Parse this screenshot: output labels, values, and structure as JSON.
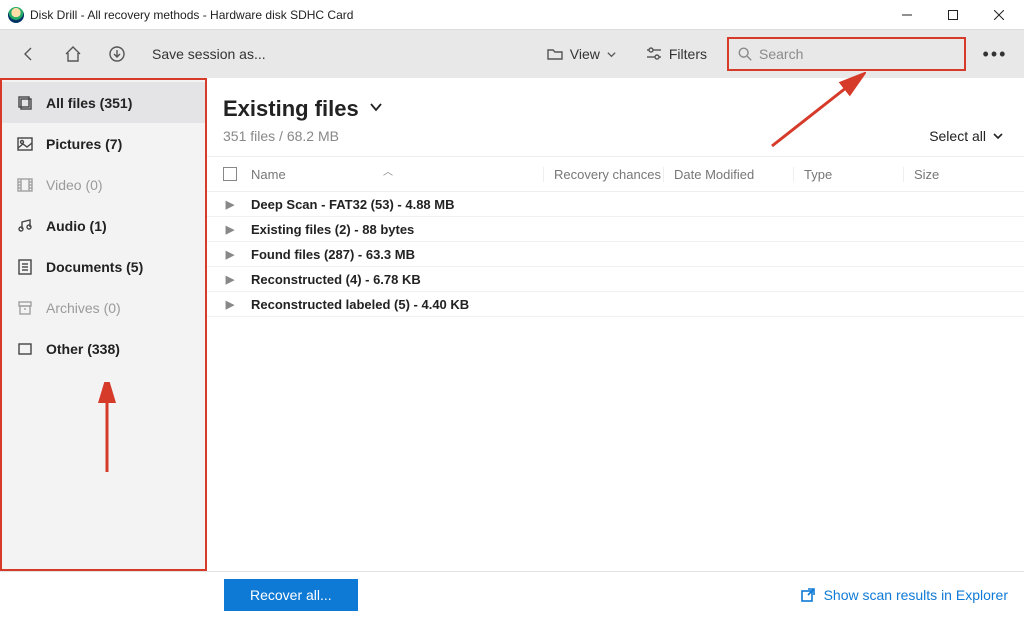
{
  "window": {
    "title": "Disk Drill - All recovery methods - Hardware disk SDHC Card"
  },
  "toolbar": {
    "save_session": "Save session as...",
    "view_label": "View",
    "filters_label": "Filters",
    "search_placeholder": "Search"
  },
  "sidebar": {
    "items": [
      {
        "label": "All files (351)",
        "icon": "stack-icon",
        "selected": true,
        "disabled": false
      },
      {
        "label": "Pictures (7)",
        "icon": "picture-icon",
        "selected": false,
        "disabled": false
      },
      {
        "label": "Video (0)",
        "icon": "video-icon",
        "selected": false,
        "disabled": true
      },
      {
        "label": "Audio (1)",
        "icon": "audio-icon",
        "selected": false,
        "disabled": false
      },
      {
        "label": "Documents (5)",
        "icon": "document-icon",
        "selected": false,
        "disabled": false
      },
      {
        "label": "Archives (0)",
        "icon": "archive-icon",
        "selected": false,
        "disabled": true
      },
      {
        "label": "Other (338)",
        "icon": "other-icon",
        "selected": false,
        "disabled": false
      }
    ]
  },
  "content": {
    "heading": "Existing files",
    "subheading": "351 files / 68.2 MB",
    "select_all": "Select all"
  },
  "columns": {
    "name": "Name",
    "recovery": "Recovery chances",
    "date": "Date Modified",
    "type": "Type",
    "size": "Size"
  },
  "rows": [
    {
      "text": "Deep Scan - FAT32 (53) - 4.88 MB"
    },
    {
      "text": "Existing files (2) - 88 bytes"
    },
    {
      "text": "Found files (287) - 63.3 MB"
    },
    {
      "text": "Reconstructed (4) - 6.78 KB"
    },
    {
      "text": "Reconstructed labeled (5) - 4.40 KB"
    }
  ],
  "footer": {
    "recover": "Recover all...",
    "show_results": "Show scan results in Explorer"
  },
  "annotation_colors": {
    "highlight": "#d63b2a"
  }
}
